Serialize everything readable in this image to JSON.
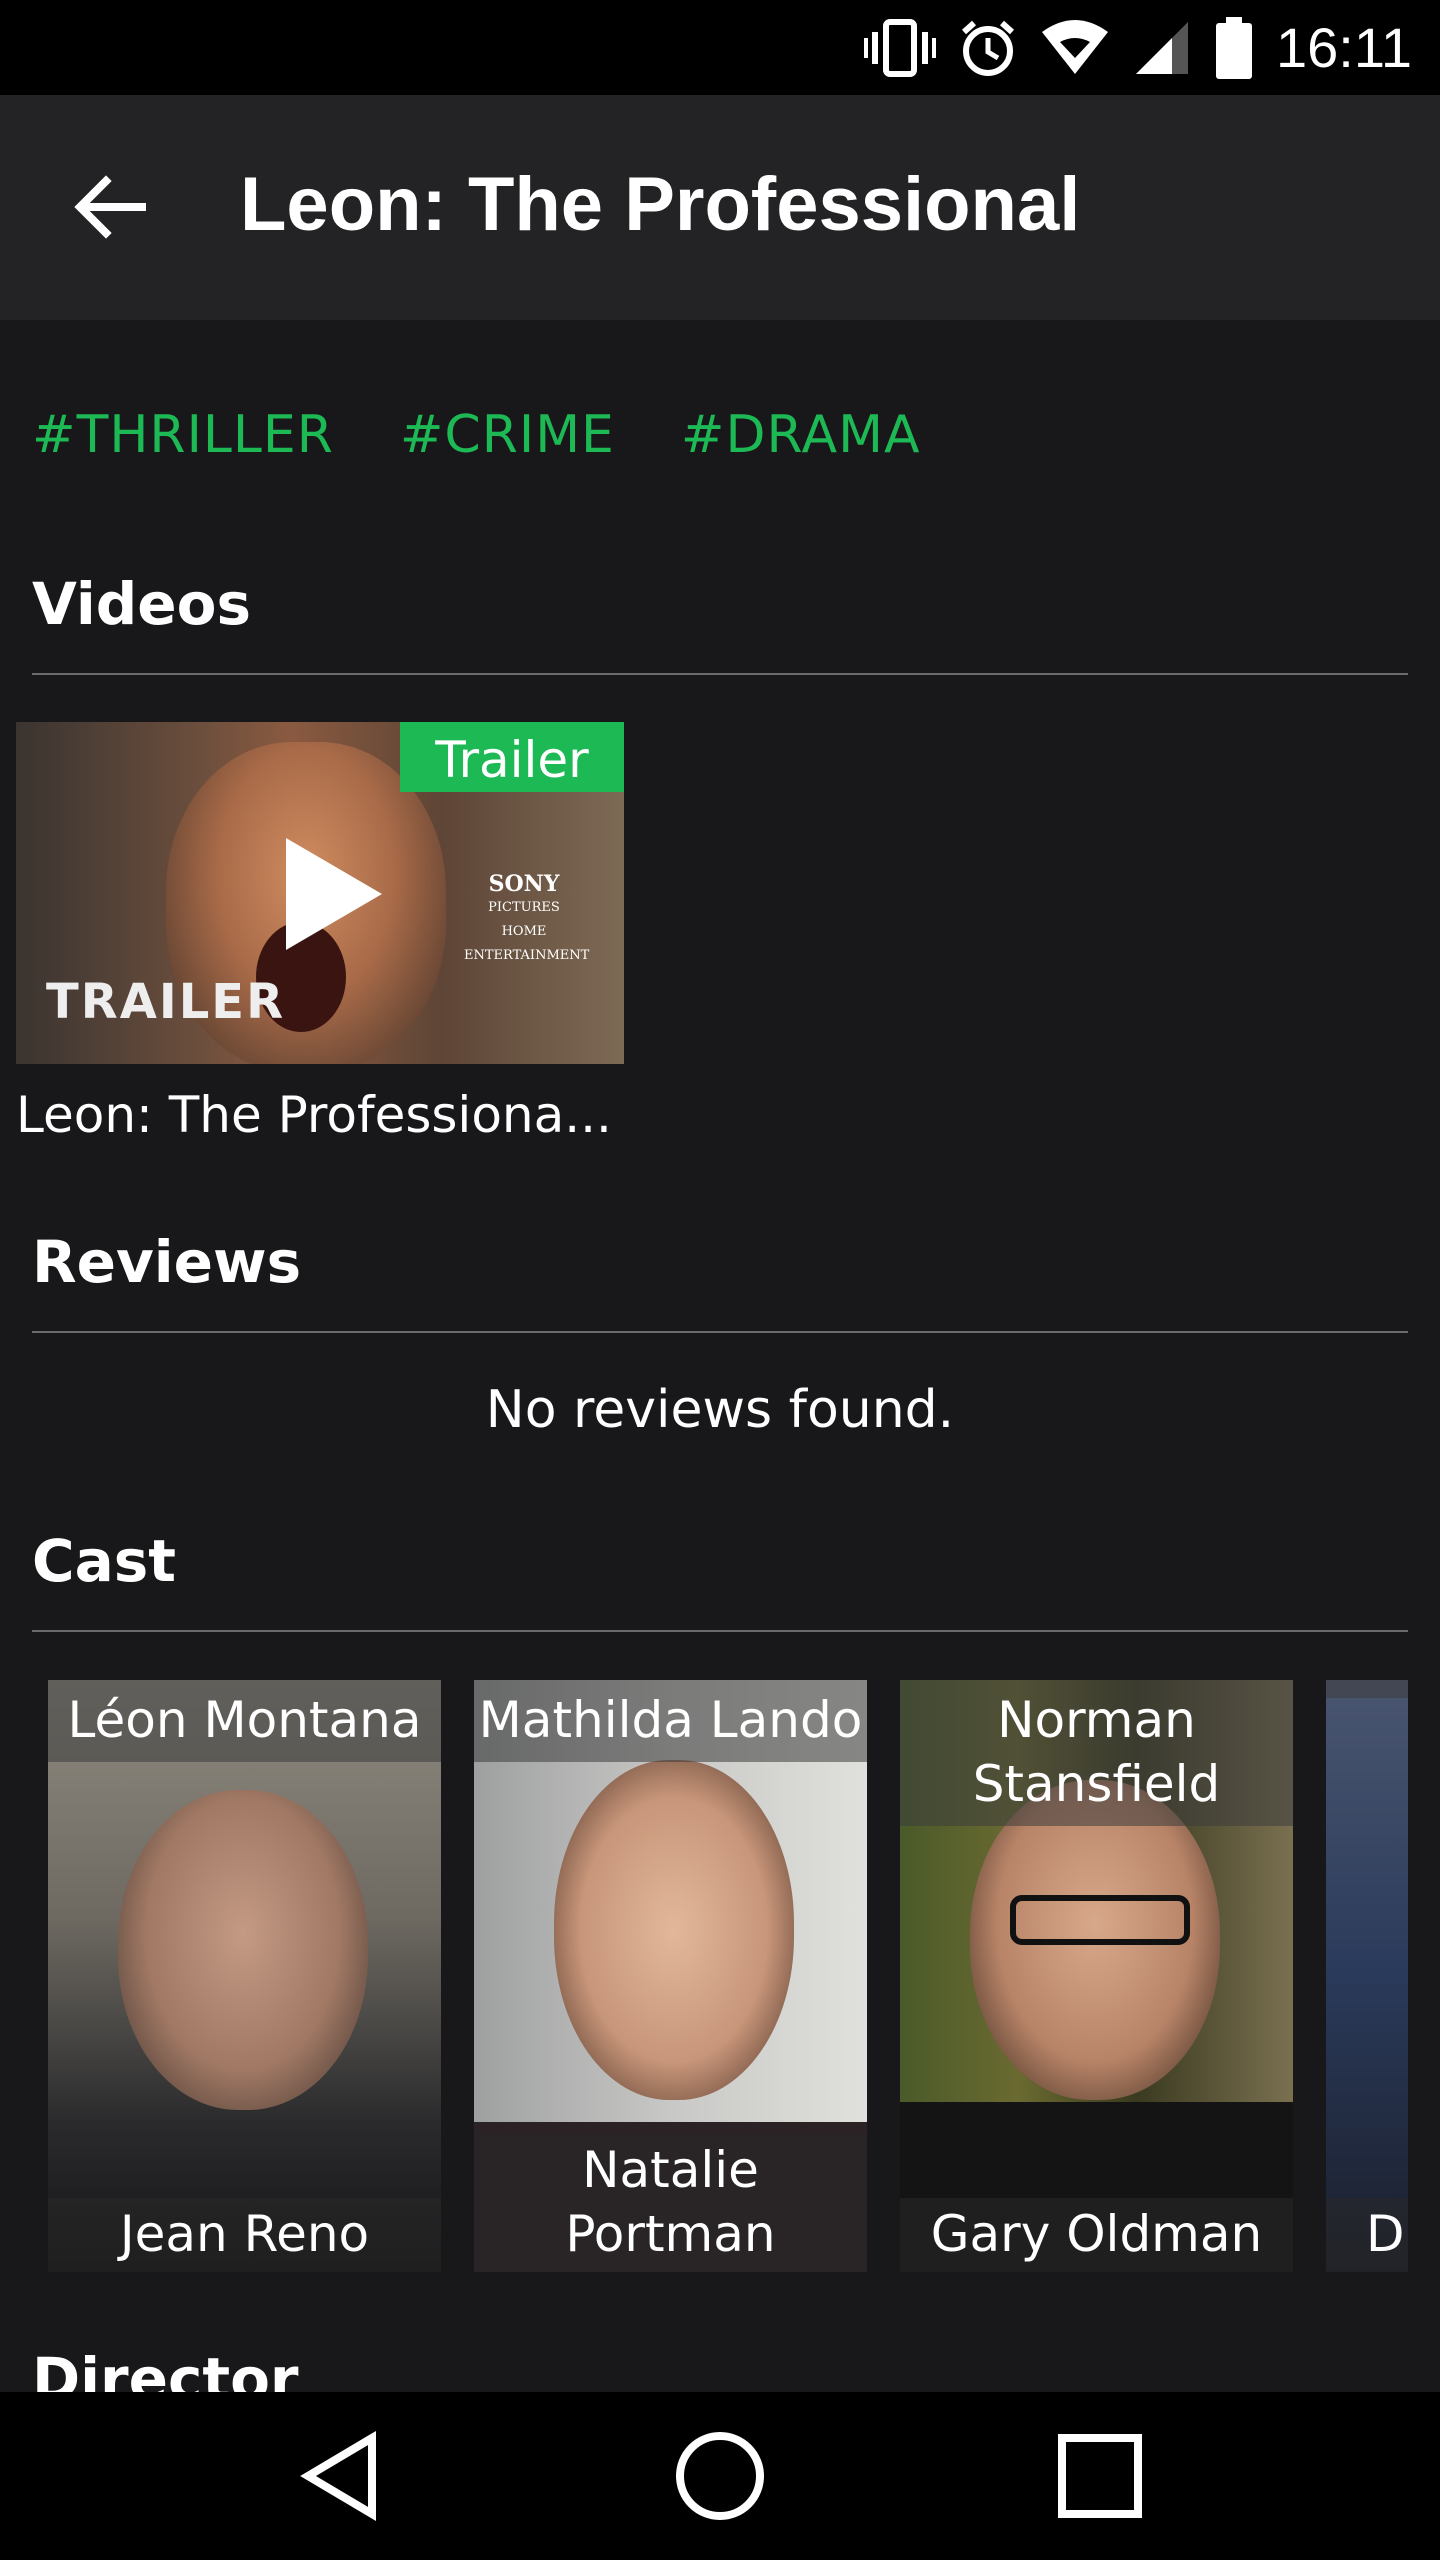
{
  "status_bar": {
    "time": "16:11",
    "icons": [
      "vibrate-icon",
      "alarm-icon",
      "wifi-icon",
      "signal-icon",
      "battery-icon"
    ]
  },
  "app_bar": {
    "back_icon": "arrow-left-icon",
    "title": "Leon: The Professional"
  },
  "genres": [
    "#THRILLER",
    "#CRIME",
    "#DRAMA"
  ],
  "videos": {
    "header": "Videos",
    "items": [
      {
        "badge": "Trailer",
        "title": "Leon: The Professiona...",
        "thumb_text": "TRAILER",
        "thumb_logo": "SONY",
        "thumb_logo_sub1": "PICTURES",
        "thumb_logo_sub2": "HOME",
        "thumb_logo_sub3": "ENTERTAINMENT"
      }
    ]
  },
  "reviews": {
    "header": "Reviews",
    "empty_text": "No reviews found."
  },
  "cast": {
    "header": "Cast",
    "items": [
      {
        "role": "Léon Montana",
        "actor": "Jean Reno"
      },
      {
        "role": "Mathilda Lando",
        "actor": "Natalie Portman"
      },
      {
        "role": "Norman Stansfield",
        "actor": "Gary Oldman"
      },
      {
        "role": "",
        "actor": "D"
      }
    ]
  },
  "director": {
    "header": "Director"
  },
  "nav_bar": {
    "icons": [
      "back-triangle-icon",
      "home-circle-icon",
      "recents-square-icon"
    ]
  },
  "colors": {
    "accent": "#1db954",
    "background": "#18181b",
    "app_bar": "#232325"
  }
}
